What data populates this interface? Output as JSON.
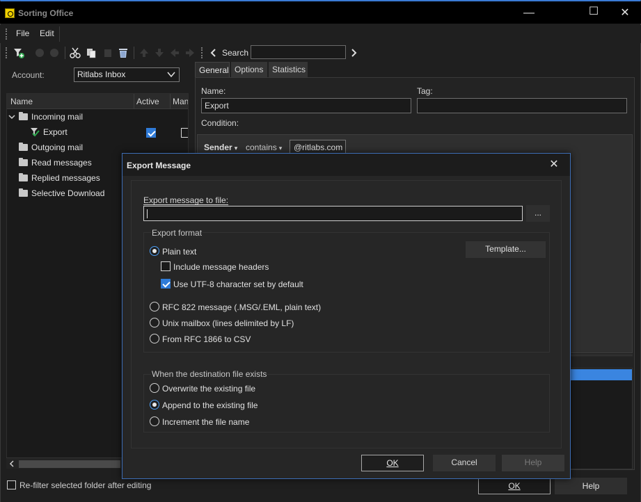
{
  "window": {
    "title": "Sorting Office",
    "minimize_glyph": "—",
    "maximize_glyph": "☐",
    "close_glyph": "✕"
  },
  "menu": {
    "file": "File",
    "edit": "Edit"
  },
  "toolbar": {
    "search_label": "Search",
    "search_value": ""
  },
  "left": {
    "account_label": "Account:",
    "account_value": "Ritlabs Inbox",
    "columns": {
      "name": "Name",
      "active": "Active",
      "manual": "Man"
    },
    "tree": {
      "incoming": "Incoming mail",
      "export": "Export",
      "outgoing": "Outgoing mail",
      "read": "Read messages",
      "replied": "Replied messages",
      "selective": "Selective Download"
    },
    "refilter_label": "Re-filter selected folder after editing"
  },
  "right": {
    "tabs": {
      "general": "General",
      "options": "Options",
      "statistics": "Statistics"
    },
    "name_label": "Name:",
    "name_value": "Export",
    "tag_label": "Tag:",
    "tag_value": "",
    "condition_label": "Condition:",
    "condition": {
      "field": "Sender",
      "operator": "contains",
      "value": "@ritlabs.com"
    },
    "ok": "OK",
    "help": "Help"
  },
  "dialog": {
    "title": "Export Message",
    "file_label": "Export message to file:",
    "file_value": "",
    "browse": "...",
    "format_group": "Export format",
    "plain_text": "Plain text",
    "include_headers": "Include message headers",
    "utf8": "Use UTF-8 character set by default",
    "template": "Template...",
    "rfc822": "RFC 822 message (.MSG/.EML, plain text)",
    "unix": "Unix mailbox (lines delimited by LF)",
    "rfc1866": "From RFC 1866 to CSV",
    "dest_group": "When the destination file exists",
    "overwrite": "Overwrite the existing file",
    "append": "Append to the existing file",
    "increment": "Increment the file name",
    "ok": "OK",
    "cancel": "Cancel",
    "help": "Help"
  }
}
